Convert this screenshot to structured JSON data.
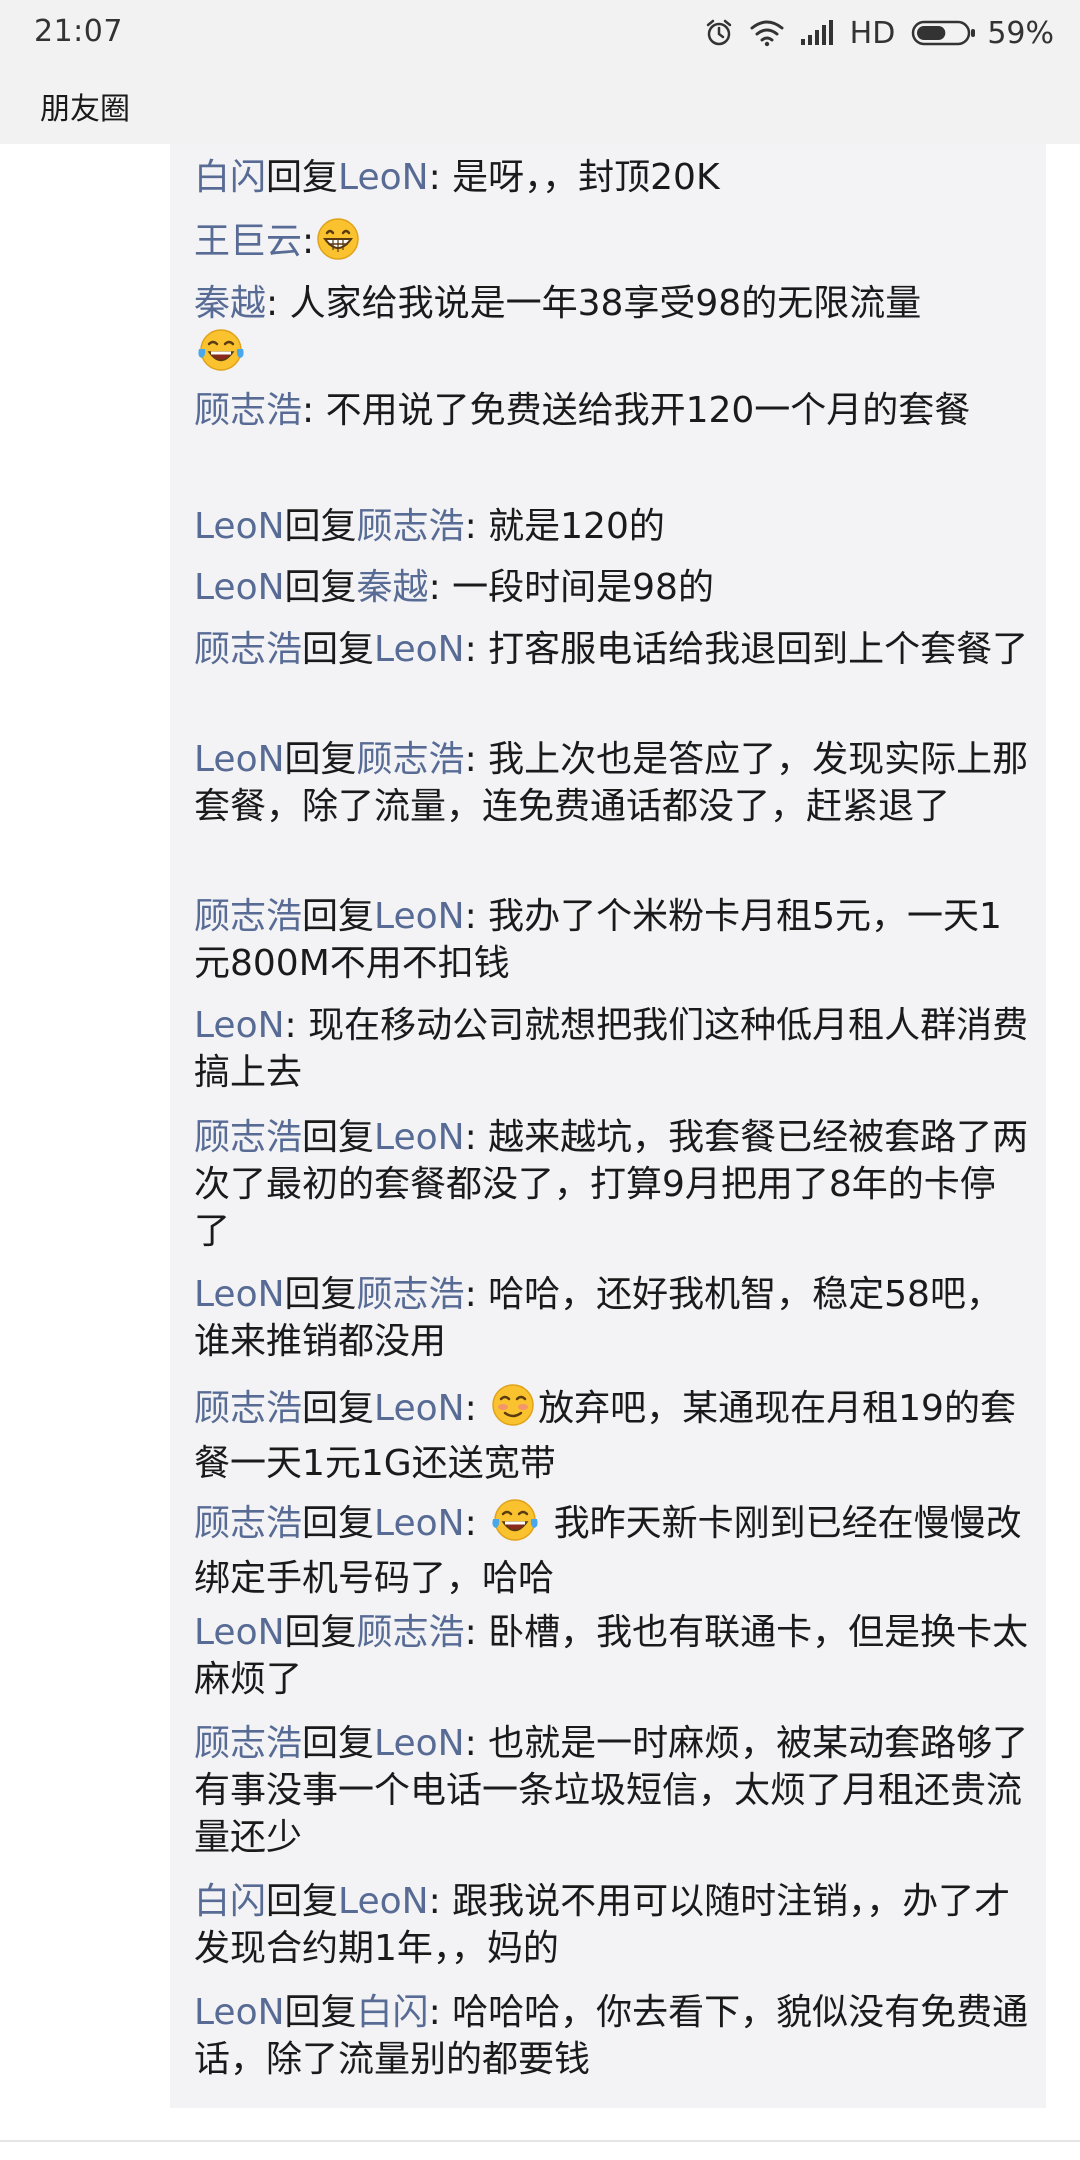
{
  "status_bar": {
    "time": "21:07",
    "network": "HD",
    "battery": "59%",
    "battery_level": 0.59
  },
  "title": "朋友圈",
  "comments": [
    {
      "author": "白闪",
      "reply_word": "回复",
      "reply_to": "LeoN",
      "text": ": 是呀，，封顶20K"
    },
    {
      "author": "王巨云",
      "text": ":"
    },
    {
      "author": "秦越",
      "text": ": 人家给我说是一年38享受98的无限流量"
    },
    {
      "author": "顾志浩",
      "text": ": 不用说了免费送给我开120一个月的套餐"
    },
    {
      "author": "LeoN",
      "reply_word": "回复",
      "reply_to": "顾志浩",
      "text": ": 就是120的"
    },
    {
      "author": "LeoN",
      "reply_word": "回复",
      "reply_to": "秦越",
      "text": ": 一段时间是98的"
    },
    {
      "author": "顾志浩",
      "reply_word": "回复",
      "reply_to": "LeoN",
      "text": ": 打客服电话给我退回到上个套餐了"
    },
    {
      "author": "LeoN",
      "reply_word": "回复",
      "reply_to": "顾志浩",
      "text": ": 我上次也是答应了，发现实际上那套餐，除了流量，连免费通话都没了，赶紧退了"
    },
    {
      "author": "顾志浩",
      "reply_word": "回复",
      "reply_to": "LeoN",
      "text": ": 我办了个米粉卡月租5元，一天1元800M不用不扣钱"
    },
    {
      "author": "LeoN",
      "text": ": 现在移动公司就想把我们这种低月租人群消费搞上去"
    },
    {
      "author": "顾志浩",
      "reply_word": "回复",
      "reply_to": "LeoN",
      "text": ": 越来越坑，我套餐已经被套路了两次了最初的套餐都没了，打算9月把用了8年的卡停了"
    },
    {
      "author": "LeoN",
      "reply_word": "回复",
      "reply_to": "顾志浩",
      "text": ": 哈哈，还好我机智，稳定58吧，谁来推销都没用"
    },
    {
      "author": "顾志浩",
      "reply_word": "回复",
      "reply_to": "LeoN",
      "text_before": ": ",
      "text": "放弃吧，某通现在月租19的套餐一天1元1G还送宽带"
    },
    {
      "author": "顾志浩",
      "reply_word": "回复",
      "reply_to": "LeoN",
      "text_before": ": ",
      "text": " 我昨天新卡刚到已经在慢慢改绑定手机号码了，哈哈"
    },
    {
      "author": "LeoN",
      "reply_word": "回复",
      "reply_to": "顾志浩",
      "text": ": 卧槽，我也有联通卡，但是换卡太麻烦了"
    },
    {
      "author": "顾志浩",
      "reply_word": "回复",
      "reply_to": "LeoN",
      "text": ": 也就是一时麻烦，被某动套路够了有事没事一个电话一条垃圾短信，太烦了月租还贵流量还少"
    },
    {
      "author": "白闪",
      "reply_word": "回复",
      "reply_to": "LeoN",
      "text": ": 跟我说不用可以随时注销，，办了才发现合约期1年，，妈的"
    },
    {
      "author": "LeoN",
      "reply_word": "回复",
      "reply_to": "白闪",
      "text": ": 哈哈哈，你去看下，貌似没有免费通话，除了流量别的都要钱"
    }
  ],
  "emoji_icons": [
    "grinning-emoji-icon",
    "tears-of-joy-emoji-icon",
    "flushed-smile-emoji-icon"
  ],
  "colors": {
    "name_link": "#576b95",
    "panel_bg": "#f3f3f5",
    "bar_bg": "#f2f2f2"
  }
}
